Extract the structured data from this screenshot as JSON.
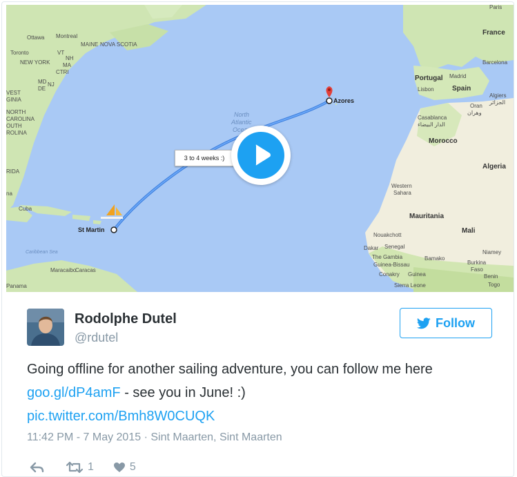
{
  "media": {
    "route_label": "3 to 4 weeks :)",
    "places": {
      "paris": "Paris",
      "france": "France",
      "barcelona": "Barcelona",
      "portugal": "Portugal",
      "madrid": "Madrid",
      "spain": "Spain",
      "lisbon": "Lisbon",
      "algiers": "Algiers",
      "algiers_ar": "الجزائر",
      "oran": "Oran",
      "oran_ar": "وهران",
      "casablanca": "Casablanca",
      "casablanca_ar": "الدار البيضاء",
      "morocco": "Morocco",
      "algeria": "Algeria",
      "western_sahara_1": "Western",
      "western_sahara_2": "Sahara",
      "mauritania": "Mauritania",
      "mali": "Mali",
      "nouakchott": "Nouakchott",
      "dakar": "Dakar",
      "senegal": "Senegal",
      "the_gambia": "The Gambia",
      "guinea_bissau": "Guinea-Bissau",
      "conakry": "Conakry",
      "guinea": "Guinea",
      "sierra_leone": "Sierra Leone",
      "bamako": "Bamako",
      "niamey": "Niamey",
      "burkina_1": "Burkina",
      "burkina_2": "Faso",
      "benin": "Benin",
      "togo": "Togo",
      "ottawa": "Ottawa",
      "montreal": "Montreal",
      "maine": "MAINE",
      "nova_scotia": "NOVA SCOTIA",
      "toronto": "Toronto",
      "vt": "VT",
      "nh": "NH",
      "new_york": "NEW YORK",
      "ma": "MA",
      "ctri": "CTRI",
      "md": "MD",
      "nj": "NJ",
      "de": "DE",
      "west": "VEST",
      "virginia": "GINIA",
      "north": "NORTH",
      "carolina": "CAROLINA",
      "south": "OUTH",
      "rolina": "ROLINA",
      "rida": "RIDA",
      "na": "na",
      "cuba": "Cuba",
      "caribbean": "Caribbean Sea",
      "maracaibo": "Maracaibo",
      "caracas": "Caracas",
      "panama": "Panama",
      "ocean_1": "North",
      "ocean_2": "Atlantic",
      "ocean_3": "Ocean",
      "st_martin": "St Martin",
      "azores": "Azores"
    }
  },
  "user": {
    "name": "Rodolphe Dutel",
    "handle": "@rdutel"
  },
  "follow_label": "Follow",
  "tweet": {
    "text_1": "Going offline for another sailing adventure, you can follow me here ",
    "link_1": "goo.gl/dP4amF",
    "text_2": " - see you in June! :)",
    "pic_link": "pic.twitter.com/Bmh8W0CUQK"
  },
  "meta": {
    "time": "11:42 PM - 7 May 2015",
    "separator": " · ",
    "location": "Sint Maarten, Sint Maarten"
  },
  "actions": {
    "retweets": "1",
    "likes": "5"
  },
  "colors": {
    "accent": "#1da1f2",
    "ocean": "#a9c9f5",
    "land": "#cde4b0",
    "desert": "#f1eede",
    "route": "#4a8ef0"
  }
}
